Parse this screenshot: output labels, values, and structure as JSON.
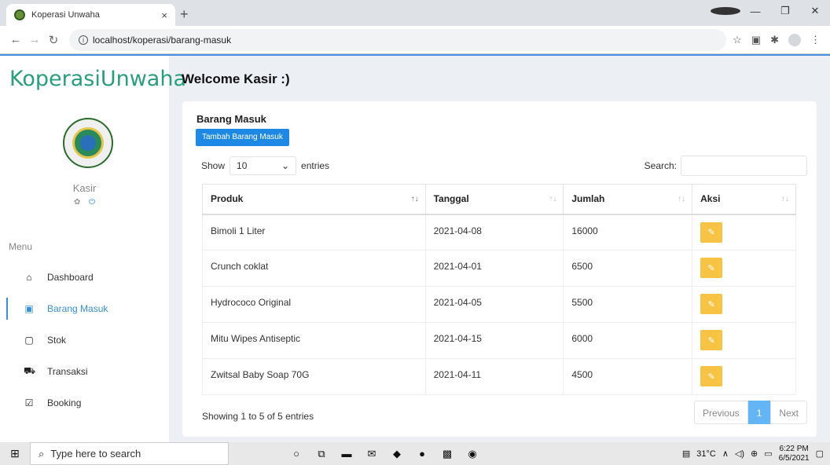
{
  "browser": {
    "tab_title": "Koperasi Unwaha",
    "tab_close": "×",
    "new_tab": "+",
    "url": "localhost/koperasi/barang-masuk"
  },
  "sidebar": {
    "brand": "KoperasiUnwaha",
    "user_name": "Kasir",
    "menu_label": "Menu",
    "items": [
      {
        "label": "Dashboard",
        "icon": "home-icon"
      },
      {
        "label": "Barang Masuk",
        "icon": "inbox-plus-icon",
        "active": true
      },
      {
        "label": "Stok",
        "icon": "box-icon"
      },
      {
        "label": "Transaksi",
        "icon": "cart-icon"
      },
      {
        "label": "Booking",
        "icon": "checkbox-icon"
      }
    ]
  },
  "header": {
    "welcome": "Welcome Kasir :)"
  },
  "card": {
    "title": "Barang Masuk",
    "add_button": "Tambah Barang Masuk",
    "show_label": "Show",
    "entries_value": "10",
    "entries_label": "entries",
    "search_label": "Search:",
    "columns": [
      "Produk",
      "Tanggal",
      "Jumlah",
      "Aksi"
    ],
    "rows": [
      [
        "Bimoli 1 Liter",
        "2021-04-08",
        "16000"
      ],
      [
        "Crunch coklat",
        "2021-04-01",
        "6500"
      ],
      [
        "Hydrococo Original",
        "2021-04-05",
        "5500"
      ],
      [
        "Mitu Wipes Antiseptic",
        "2021-04-15",
        "6000"
      ],
      [
        "Zwitsal Baby Soap 70G",
        "2021-04-11",
        "4500"
      ]
    ],
    "info": "Showing 1 to 5 of 5 entries",
    "pager": {
      "previous": "Previous",
      "current": "1",
      "next": "Next"
    }
  },
  "taskbar": {
    "search_placeholder": "Type here to search",
    "temperature": "31°C",
    "time": "6:22 PM",
    "date": "6/5/2021"
  },
  "colors": {
    "accent": "#1e88e5",
    "brand": "#2a9d7c",
    "edit_button": "#f6c344"
  }
}
